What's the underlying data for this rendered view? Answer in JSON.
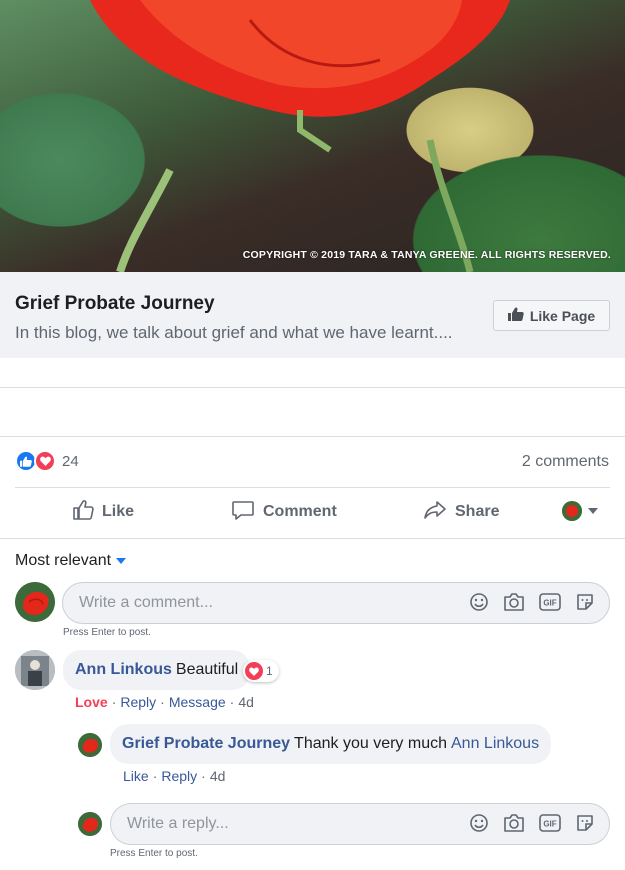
{
  "post": {
    "image_caption": "COPYRIGHT © 2019 TARA & TANYA GREENE. ALL RIGHTS RESERVED.",
    "link_title": "Grief Probate Journey",
    "link_description": "In this blog, we talk about grief and what we have learnt....",
    "like_page_label": "Like Page"
  },
  "reactions": {
    "count": "24",
    "comments_count": "2 comments"
  },
  "actions": {
    "like": "Like",
    "comment": "Comment",
    "share": "Share"
  },
  "sort": {
    "label": "Most relevant"
  },
  "composer": {
    "placeholder": "Write a comment...",
    "hint": "Press Enter to post."
  },
  "comments": [
    {
      "author": "Ann Linkous",
      "text": "Beautiful",
      "reaction_count": "1",
      "reaction_label": "Love",
      "reply_label": "Reply",
      "message_label": "Message",
      "time": "4d"
    }
  ],
  "reply": {
    "author": "Grief Probate Journey",
    "text": "Thank you very much",
    "mention": "Ann Linkous",
    "like_label": "Like",
    "reply_label": "Reply",
    "time": "4d"
  },
  "reply_composer": {
    "placeholder": "Write a reply...",
    "hint": "Press Enter to post."
  },
  "colors": {
    "accent": "#1877f2",
    "love": "#f33e58",
    "link": "#385898"
  },
  "icons": [
    "thumbs-up-icon",
    "comment-icon",
    "share-icon",
    "emoji-icon",
    "camera-icon",
    "gif-icon",
    "sticker-icon",
    "heart-icon"
  ]
}
